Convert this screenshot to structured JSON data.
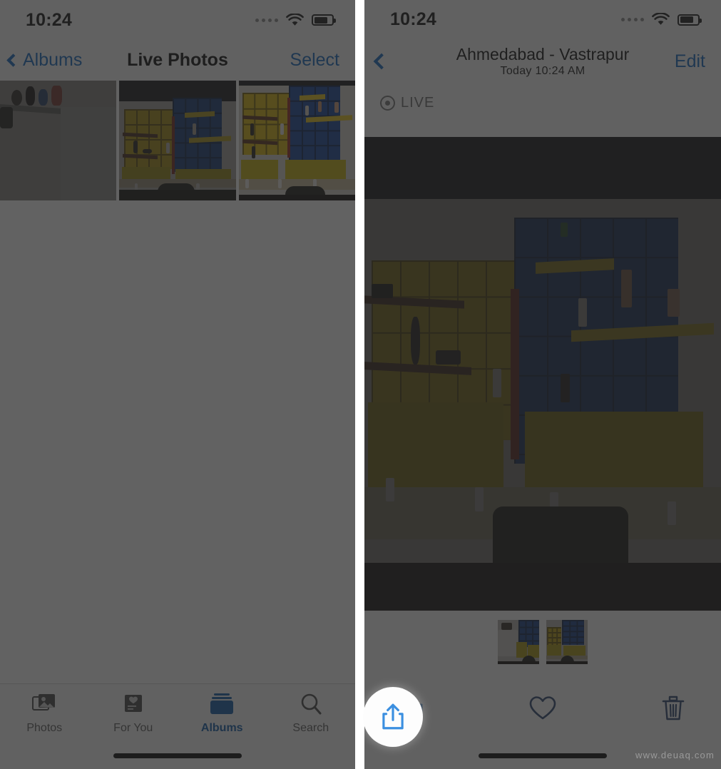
{
  "left_screen": {
    "status_bar": {
      "time": "10:24",
      "wifi_icon": "wifi-icon",
      "battery_icon": "battery-icon",
      "signal_icon": "signal-dots-icon"
    },
    "nav": {
      "back_label": "Albums",
      "back_icon": "chevron-left-icon",
      "title": "Live Photos",
      "action_label": "Select"
    },
    "grid": {
      "items": [
        {
          "name": "live-photo-thumbnail-1"
        },
        {
          "name": "live-photo-thumbnail-2"
        },
        {
          "name": "live-photo-thumbnail-3"
        }
      ]
    },
    "tabbar": {
      "items": [
        {
          "label": "Photos",
          "icon": "photos-icon",
          "active": false
        },
        {
          "label": "For You",
          "icon": "for-you-icon",
          "active": false
        },
        {
          "label": "Albums",
          "icon": "albums-icon",
          "active": true
        },
        {
          "label": "Search",
          "icon": "search-icon",
          "active": false
        }
      ]
    }
  },
  "right_screen": {
    "status_bar": {
      "time": "10:24",
      "wifi_icon": "wifi-icon",
      "battery_icon": "battery-icon",
      "signal_icon": "signal-dots-icon"
    },
    "nav": {
      "back_icon": "chevron-left-icon",
      "title": "Ahmedabad - Vastrapur",
      "subtitle": "Today  10:24 AM",
      "action_label": "Edit"
    },
    "live_badge": {
      "label": "LIVE",
      "icon": "live-photo-icon"
    },
    "filmstrip": [
      {
        "name": "filmstrip-thumbnail-1"
      },
      {
        "name": "filmstrip-thumbnail-2"
      }
    ],
    "toolbar": {
      "share_icon": "share-icon",
      "favorite_icon": "heart-icon",
      "delete_icon": "trash-icon"
    }
  },
  "colors": {
    "accent_blue": "#1268c3",
    "tab_active_blue": "#0f5aa8",
    "dim_overlay": "#4a4a4a",
    "highlight_circle": "#fdfdfd"
  },
  "watermark": {
    "text": "www.deuaq.com"
  }
}
